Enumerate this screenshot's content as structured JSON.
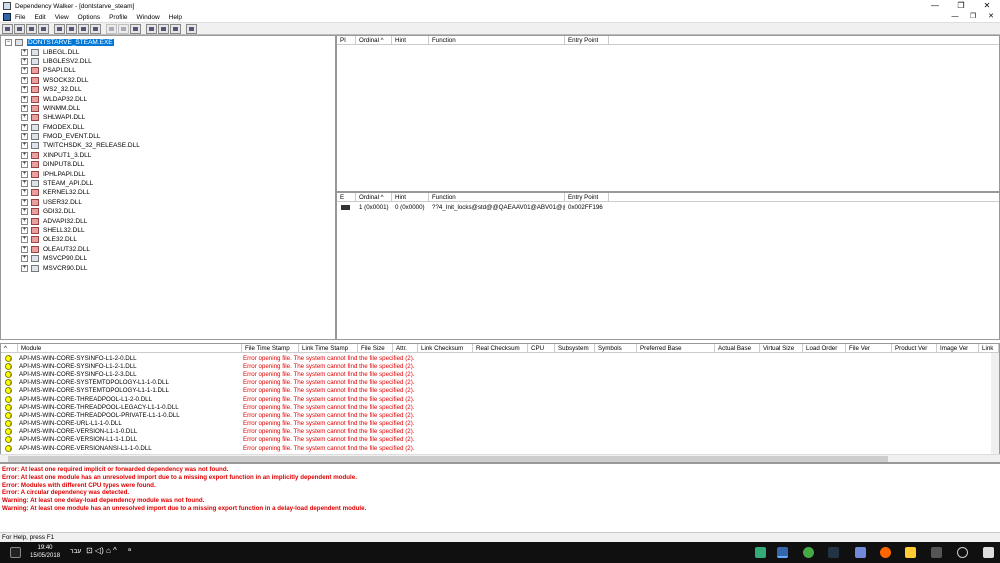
{
  "window": {
    "title": "Dependency Walker - [dontstarve_steam]",
    "minimize": "—",
    "maximize": "❐",
    "close": "✕"
  },
  "menu": [
    "File",
    "Edit",
    "View",
    "Options",
    "Profile",
    "Window",
    "Help"
  ],
  "mdi": {
    "minimize": "—",
    "restore": "❐",
    "close": "✕"
  },
  "toolbar_buttons": [
    {
      "name": "open-icon",
      "enabled": true
    },
    {
      "name": "save-icon",
      "enabled": true
    },
    {
      "name": "find-icon",
      "enabled": true
    },
    {
      "name": "copy-icon",
      "enabled": true
    },
    {
      "name": "full-paths-icon",
      "enabled": true
    },
    {
      "name": "undecorate-icon",
      "enabled": true
    },
    {
      "name": "module-info-icon",
      "enabled": true
    },
    {
      "name": "matching-icon",
      "enabled": true
    },
    {
      "name": "expand-all-icon",
      "enabled": false
    },
    {
      "name": "collapse-all-icon",
      "enabled": false
    },
    {
      "name": "configure-icon",
      "enabled": true
    },
    {
      "name": "cascade-icon",
      "enabled": true
    },
    {
      "name": "tile-horizontal-icon",
      "enabled": true
    },
    {
      "name": "tile-vertical-icon",
      "enabled": true
    },
    {
      "name": "help-icon",
      "enabled": true
    }
  ],
  "tree": {
    "root": "DONTSTARVE_STEAM.EXE",
    "children": [
      {
        "name": "LIBEGL.DLL",
        "warn": false
      },
      {
        "name": "LIBGLESV2.DLL",
        "warn": false
      },
      {
        "name": "PSAPI.DLL",
        "warn": true
      },
      {
        "name": "WSOCK32.DLL",
        "warn": true
      },
      {
        "name": "WS2_32.DLL",
        "warn": true
      },
      {
        "name": "WLDAP32.DLL",
        "warn": true
      },
      {
        "name": "WINMM.DLL",
        "warn": true
      },
      {
        "name": "SHLWAPI.DLL",
        "warn": true
      },
      {
        "name": "FMODEX.DLL",
        "warn": false
      },
      {
        "name": "FMOD_EVENT.DLL",
        "warn": false
      },
      {
        "name": "TWITCHSDK_32_RELEASE.DLL",
        "warn": false
      },
      {
        "name": "XINPUT1_3.DLL",
        "warn": true
      },
      {
        "name": "DINPUT8.DLL",
        "warn": true
      },
      {
        "name": "IPHLPAPI.DLL",
        "warn": true
      },
      {
        "name": "STEAM_API.DLL",
        "warn": false
      },
      {
        "name": "KERNEL32.DLL",
        "warn": true
      },
      {
        "name": "USER32.DLL",
        "warn": true
      },
      {
        "name": "GDI32.DLL",
        "warn": true
      },
      {
        "name": "ADVAPI32.DLL",
        "warn": true
      },
      {
        "name": "SHELL32.DLL",
        "warn": true
      },
      {
        "name": "OLE32.DLL",
        "warn": true
      },
      {
        "name": "OLEAUT32.DLL",
        "warn": true
      },
      {
        "name": "MSVCP90.DLL",
        "warn": false
      },
      {
        "name": "MSVCR90.DLL",
        "warn": false
      }
    ]
  },
  "imports": {
    "columns": [
      "PI",
      "Ordinal ^",
      "Hint",
      "Function",
      "Entry Point"
    ],
    "rows": []
  },
  "exports": {
    "columns": [
      "E",
      "Ordinal ^",
      "Hint",
      "Function",
      "Entry Point"
    ],
    "rows": [
      {
        "ordinal": "1 (0x0001)",
        "hint": "0 (0x0000)",
        "function": "??4_Init_locks@std@@QAEAAV01@ABV01@@Z",
        "entry": "0x002FF196"
      }
    ]
  },
  "modules": {
    "columns": [
      "^",
      "Module",
      "File Time Stamp",
      "Link Time Stamp",
      "File Size",
      "Attr.",
      "Link Checksum",
      "Real Checksum",
      "CPU",
      "Subsystem",
      "Symbols",
      "Preferred Base",
      "Actual Base",
      "Virtual Size",
      "Load Order",
      "File Ver",
      "Product Ver",
      "Image Ver",
      "Link"
    ],
    "rows": [
      {
        "module": "API-MS-WIN-CORE-SYSINFO-L1-2-0.DLL",
        "msg": "Error opening file. The system cannot find the file specified (2)."
      },
      {
        "module": "API-MS-WIN-CORE-SYSINFO-L1-2-1.DLL",
        "msg": "Error opening file. The system cannot find the file specified (2)."
      },
      {
        "module": "API-MS-WIN-CORE-SYSINFO-L1-2-3.DLL",
        "msg": "Error opening file. The system cannot find the file specified (2)."
      },
      {
        "module": "API-MS-WIN-CORE-SYSTEMTOPOLOGY-L1-1-0.DLL",
        "msg": "Error opening file. The system cannot find the file specified (2)."
      },
      {
        "module": "API-MS-WIN-CORE-SYSTEMTOPOLOGY-L1-1-1.DLL",
        "msg": "Error opening file. The system cannot find the file specified (2)."
      },
      {
        "module": "API-MS-WIN-CORE-THREADPOOL-L1-2-0.DLL",
        "msg": "Error opening file. The system cannot find the file specified (2)."
      },
      {
        "module": "API-MS-WIN-CORE-THREADPOOL-LEGACY-L1-1-0.DLL",
        "msg": "Error opening file. The system cannot find the file specified (2)."
      },
      {
        "module": "API-MS-WIN-CORE-THREADPOOL-PRIVATE-L1-1-0.DLL",
        "msg": "Error opening file. The system cannot find the file specified (2)."
      },
      {
        "module": "API-MS-WIN-CORE-URL-L1-1-0.DLL",
        "msg": "Error opening file. The system cannot find the file specified (2)."
      },
      {
        "module": "API-MS-WIN-CORE-VERSION-L1-1-0.DLL",
        "msg": "Error opening file. The system cannot find the file specified (2)."
      },
      {
        "module": "API-MS-WIN-CORE-VERSION-L1-1-1.DLL",
        "msg": "Error opening file. The system cannot find the file specified (2)."
      },
      {
        "module": "API-MS-WIN-CORE-VERSIONANSI-L1-1-0.DLL",
        "msg": "Error opening file. The system cannot find the file specified (2)."
      }
    ]
  },
  "log": [
    {
      "text": "Error: At least one required implicit or forwarded dependency was not found.",
      "color": "#e00000"
    },
    {
      "text": "Error: At least one module has an unresolved import due to a missing export function in an implicitly dependent module.",
      "color": "#e00000"
    },
    {
      "text": "Error: Modules with different CPU types were found.",
      "color": "#e00000"
    },
    {
      "text": "Error: A circular dependency was detected.",
      "color": "#e00000"
    },
    {
      "text": "Warning: At least one delay-load dependency module was not found.",
      "color": "#e00000"
    },
    {
      "text": "Warning: At least one module has an unresolved import due to a missing export function in a delay-load dependent module.",
      "color": "#e00000"
    }
  ],
  "status": "For Help, press F1",
  "taskbar": {
    "time": "19:40",
    "date": "15/05/2018",
    "lang": "עבר"
  }
}
